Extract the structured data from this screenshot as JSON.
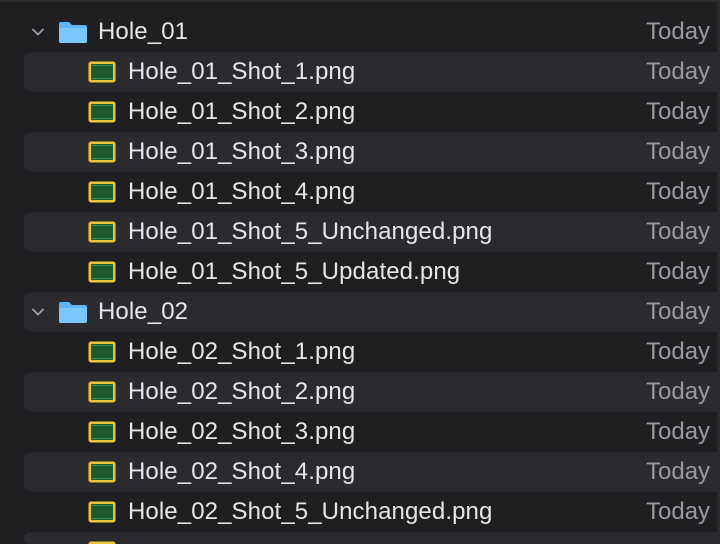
{
  "rows": [
    {
      "kind": "folder",
      "name": "Hole_01",
      "date": "Today",
      "expanded": true
    },
    {
      "kind": "file",
      "name": "Hole_01_Shot_1.png",
      "date": "Today"
    },
    {
      "kind": "file",
      "name": "Hole_01_Shot_2.png",
      "date": "Today"
    },
    {
      "kind": "file",
      "name": "Hole_01_Shot_3.png",
      "date": "Today"
    },
    {
      "kind": "file",
      "name": "Hole_01_Shot_4.png",
      "date": "Today"
    },
    {
      "kind": "file",
      "name": "Hole_01_Shot_5_Unchanged.png",
      "date": "Today"
    },
    {
      "kind": "file",
      "name": "Hole_01_Shot_5_Updated.png",
      "date": "Today"
    },
    {
      "kind": "folder",
      "name": "Hole_02",
      "date": "Today",
      "expanded": true
    },
    {
      "kind": "file",
      "name": "Hole_02_Shot_1.png",
      "date": "Today"
    },
    {
      "kind": "file",
      "name": "Hole_02_Shot_2.png",
      "date": "Today"
    },
    {
      "kind": "file",
      "name": "Hole_02_Shot_3.png",
      "date": "Today"
    },
    {
      "kind": "file",
      "name": "Hole_02_Shot_4.png",
      "date": "Today"
    },
    {
      "kind": "file",
      "name": "Hole_02_Shot_5_Unchanged.png",
      "date": "Today"
    }
  ],
  "icons": {
    "folder": "folder-icon",
    "file": "png-image-file-icon",
    "disclosure": "chevron-down-icon"
  },
  "colors": {
    "folder_blue": "#5fb4f5",
    "file_green": "#1f5a2e",
    "file_yellow": "#e8c63a"
  }
}
